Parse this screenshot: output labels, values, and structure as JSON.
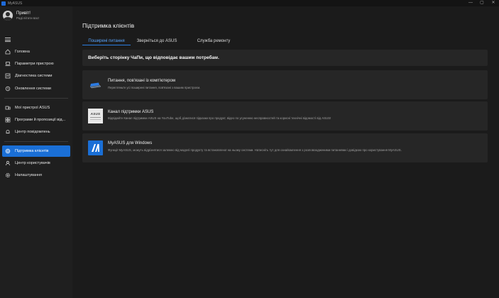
{
  "titlebar": {
    "app_name": "MyASUS",
    "minimize": "—",
    "maximize": "▢",
    "close": "✕"
  },
  "profile": {
    "greeting": "Привіт!",
    "subtitle": "Раді вітати вас!"
  },
  "sidebar": {
    "items": [
      {
        "label": "Головна"
      },
      {
        "label": "Параметри пристрою"
      },
      {
        "label": "Діагностика системи"
      },
      {
        "label": "Оновлення системи"
      },
      {
        "label": "Мої пристрої ASUS"
      },
      {
        "label": "Програми й пропозиції від..."
      },
      {
        "label": "Центр повідомлень"
      },
      {
        "label": "Підтримка клієнтів"
      },
      {
        "label": "Центр користувачів"
      },
      {
        "label": "Налаштування"
      }
    ],
    "active_index": 7
  },
  "main": {
    "title": "Підтримка клієнтів",
    "tabs": [
      {
        "label": "Поширені питання"
      },
      {
        "label": "Зверніться до ASUS"
      },
      {
        "label": "Служба ремонту"
      }
    ],
    "banner": "Виберіть сторінку ЧаПи, що відповідає вашим потребам.",
    "cards": [
      {
        "title": "Питання, пов'язані із комп'ютером",
        "desc": "Перегляньте усі поширені питання, пов'язані з вашим пристроєм."
      },
      {
        "title": "Канал підтримки ASUS",
        "desc": "Відвідайте Канал підтримки ASUS на YouTube, щоб дізнатися підказки про продукт, відео по усуненню несправностей та корисні технічні відомості від ASUS!",
        "thumb_text": "ASUS"
      },
      {
        "title": "MyASUS для Windows",
        "desc": "Функції MyASUS, можуть відрізнятися залежно від моделі продукту та встановленої на ньому системи. Натисніть тут для ознайомлення з розповсюдженими питаннями і довідкою про користування MyASUS."
      }
    ]
  },
  "colors": {
    "accent": "#1a6fd6",
    "background": "#1b1b1b",
    "card": "#262626"
  }
}
